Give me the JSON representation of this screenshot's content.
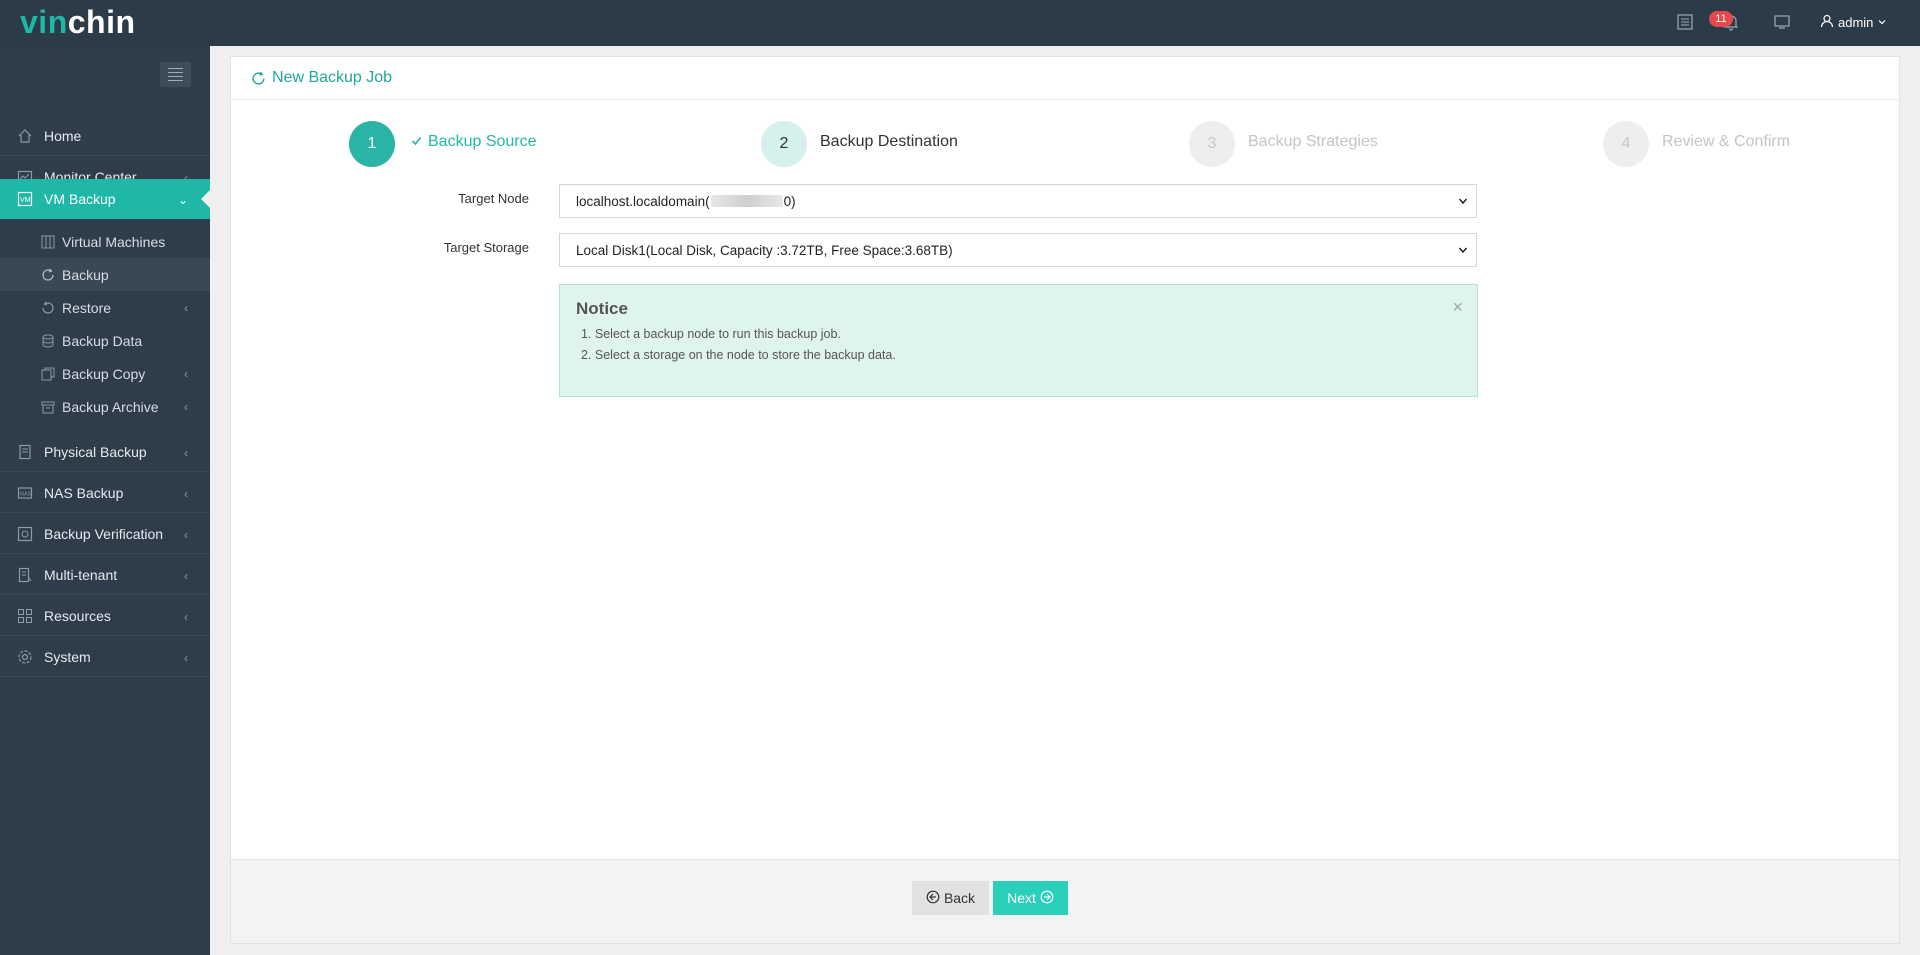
{
  "app": {
    "logo_part1": "vin",
    "logo_part2": "chin",
    "colors": {
      "accent": "#1fb8a7",
      "topbar": "#2c3b48",
      "sidebar": "#2f3d4a"
    }
  },
  "header": {
    "notification_count": "11",
    "user_name": "admin",
    "icons": [
      "list-icon",
      "bell-icon",
      "monitor-icon",
      "user-icon",
      "chevron-down-icon"
    ]
  },
  "sidebar": {
    "items": [
      {
        "label": "Home",
        "icon": "home-icon"
      },
      {
        "label": "Monitor Center",
        "icon": "monitor-center-icon"
      },
      {
        "label": "VM Backup",
        "icon": "vm-icon"
      },
      {
        "label": "Physical Backup",
        "icon": "server-icon"
      },
      {
        "label": "NAS Backup",
        "icon": "nas-icon"
      },
      {
        "label": "Backup Verification",
        "icon": "verification-icon"
      },
      {
        "label": "Multi-tenant",
        "icon": "tenant-icon"
      },
      {
        "label": "Resources",
        "icon": "resources-icon"
      },
      {
        "label": "System",
        "icon": "gear-icon"
      }
    ],
    "vm_sub_items": [
      {
        "label": "Virtual Machines"
      },
      {
        "label": "Backup"
      },
      {
        "label": "Restore"
      },
      {
        "label": "Backup Data"
      },
      {
        "label": "Backup Copy"
      },
      {
        "label": "Backup Archive"
      }
    ]
  },
  "main": {
    "title": "New Backup Job",
    "steps": [
      {
        "number": "1",
        "label": "Backup Source"
      },
      {
        "number": "2",
        "label": "Backup Destination"
      },
      {
        "number": "3",
        "label": "Backup Strategies"
      },
      {
        "number": "4",
        "label": "Review & Confirm"
      }
    ],
    "form": {
      "target_node_label": "Target Node",
      "target_node_value": "localhost.localdomain(",
      "target_node_value_end": "0)",
      "target_storage_label": "Target Storage",
      "target_storage_value": "Local Disk1(Local Disk, Capacity :3.72TB, Free Space:3.68TB)"
    },
    "notice": {
      "title": "Notice",
      "lines": [
        "1. Select a backup node to run this backup job.",
        "2. Select a storage on the node to store the backup data."
      ]
    },
    "buttons": {
      "back": "Back",
      "next": "Next"
    }
  }
}
